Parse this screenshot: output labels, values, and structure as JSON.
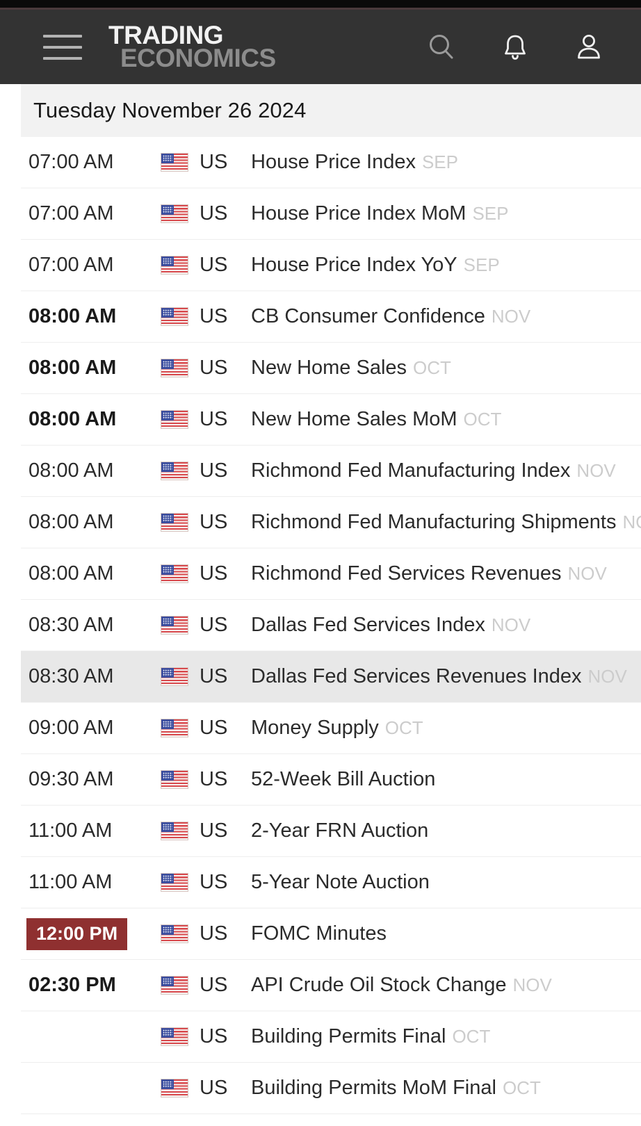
{
  "topbar": {
    "accent_color": "#4a3a3c"
  },
  "header": {
    "brand_line1": "TRADING",
    "brand_line2": "ECONOMICS",
    "menu_label": "Menu",
    "icons": [
      "search-icon",
      "bell-icon",
      "user-icon"
    ],
    "bg_color": "#333333"
  },
  "datebar": {
    "date": "Tuesday November 26 2024"
  },
  "table": {
    "highlight_color": "#e8e8e8",
    "badge_color": "#8f3030",
    "rows": [
      {
        "time": "07:00 AM",
        "bold": false,
        "badge": false,
        "country": "US",
        "event": "House Price Index",
        "ref": "SEP",
        "highlight": false
      },
      {
        "time": "07:00 AM",
        "bold": false,
        "badge": false,
        "country": "US",
        "event": "House Price Index MoM",
        "ref": "SEP",
        "highlight": false
      },
      {
        "time": "07:00 AM",
        "bold": false,
        "badge": false,
        "country": "US",
        "event": "House Price Index YoY",
        "ref": "SEP",
        "highlight": false
      },
      {
        "time": "08:00 AM",
        "bold": true,
        "badge": false,
        "country": "US",
        "event": "CB Consumer Confidence",
        "ref": "NOV",
        "highlight": false
      },
      {
        "time": "08:00 AM",
        "bold": true,
        "badge": false,
        "country": "US",
        "event": "New Home Sales",
        "ref": "OCT",
        "highlight": false
      },
      {
        "time": "08:00 AM",
        "bold": true,
        "badge": false,
        "country": "US",
        "event": "New Home Sales MoM",
        "ref": "OCT",
        "highlight": false
      },
      {
        "time": "08:00 AM",
        "bold": false,
        "badge": false,
        "country": "US",
        "event": "Richmond Fed Manufacturing Index",
        "ref": "NOV",
        "highlight": false
      },
      {
        "time": "08:00 AM",
        "bold": false,
        "badge": false,
        "country": "US",
        "event": "Richmond Fed Manufacturing Shipments",
        "ref": "NOV",
        "highlight": false
      },
      {
        "time": "08:00 AM",
        "bold": false,
        "badge": false,
        "country": "US",
        "event": "Richmond Fed Services Revenues",
        "ref": "NOV",
        "highlight": false
      },
      {
        "time": "08:30 AM",
        "bold": false,
        "badge": false,
        "country": "US",
        "event": "Dallas Fed Services Index",
        "ref": "NOV",
        "highlight": false
      },
      {
        "time": "08:30 AM",
        "bold": false,
        "badge": false,
        "country": "US",
        "event": "Dallas Fed Services Revenues Index",
        "ref": "NOV",
        "highlight": true
      },
      {
        "time": "09:00 AM",
        "bold": false,
        "badge": false,
        "country": "US",
        "event": "Money Supply",
        "ref": "OCT",
        "highlight": false
      },
      {
        "time": "09:30 AM",
        "bold": false,
        "badge": false,
        "country": "US",
        "event": "52-Week Bill Auction",
        "ref": "",
        "highlight": false
      },
      {
        "time": "11:00 AM",
        "bold": false,
        "badge": false,
        "country": "US",
        "event": "2-Year FRN Auction",
        "ref": "",
        "highlight": false
      },
      {
        "time": "11:00 AM",
        "bold": false,
        "badge": false,
        "country": "US",
        "event": "5-Year Note Auction",
        "ref": "",
        "highlight": false
      },
      {
        "time": "12:00 PM",
        "bold": true,
        "badge": true,
        "country": "US",
        "event": "FOMC Minutes",
        "ref": "",
        "highlight": false
      },
      {
        "time": "02:30 PM",
        "bold": true,
        "badge": false,
        "country": "US",
        "event": "API Crude Oil Stock Change",
        "ref": "NOV",
        "highlight": false
      },
      {
        "time": "",
        "bold": false,
        "badge": false,
        "country": "US",
        "event": "Building Permits Final",
        "ref": "OCT",
        "highlight": false
      },
      {
        "time": "",
        "bold": false,
        "badge": false,
        "country": "US",
        "event": "Building Permits MoM Final",
        "ref": "OCT",
        "highlight": false
      }
    ]
  }
}
